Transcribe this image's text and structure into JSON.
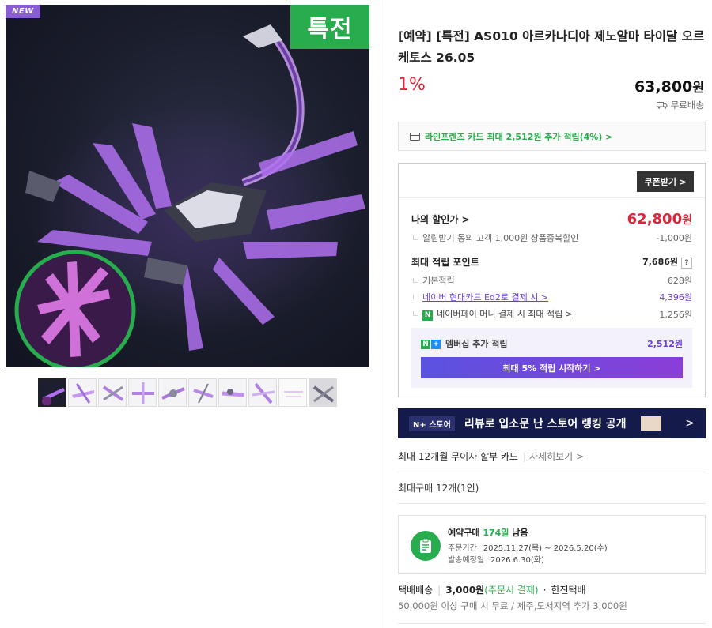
{
  "image": {
    "badge_new": "NEW",
    "badge_special": "특전"
  },
  "product": {
    "title": "[예약] [특전] AS010 아르카나디아 제노알마 타이달 오르케토스 26.05",
    "discount": "1%",
    "price": "63,800",
    "price_unit": "원",
    "shipping": "무료배송"
  },
  "card_benefit": "라인프렌즈 카드 최대 2,512원 추가 적립(4%) >",
  "benefit": {
    "coupon_button": "쿠폰받기 >",
    "my_price_label": "나의 할인가 >",
    "my_price": "62,800",
    "my_price_unit": "원",
    "alarm_label": "알림받기 동의 고객 1,000원 상품중복할인",
    "alarm_value": "-1,000원",
    "max_point_label": "최대 적립 포인트",
    "max_point_value": "7,686원",
    "help": "?",
    "base_label": "기본적립",
    "base_value": "628원",
    "hyundai_label": "네이버 현대카드 Ed2로 결제 시 >",
    "hyundai_value": "4,396원",
    "npay_icon": "N",
    "npay_label": "네이버페이 머니 결제 시 최대 적립 >",
    "npay_value": "1,256원",
    "member_n": "N",
    "member_plus": "+",
    "member_label": "멤버십 추가 적립",
    "member_value": "2,512원",
    "member_button": "최대 5% 적립 시작하기 >"
  },
  "banner": {
    "logo": "N+ 스토어",
    "text": "리뷰로 입소문 난 스토어 랭킹 공개",
    "arrow": ">"
  },
  "installment": {
    "label": "최대 12개월 무이자 할부 카드",
    "more": "자세히보기 >"
  },
  "max_buy": "최대구매 12개(1인)",
  "preorder": {
    "title_prefix": "예약구매",
    "days": "174일",
    "title_suffix": "남음",
    "order_key": "주문기간",
    "order_value": "2025.11.27(목) ~ 2026.5.20(수)",
    "ship_key": "발송예정일",
    "ship_value": "2026.6.30(화)"
  },
  "delivery": {
    "type": "택배배송",
    "fee": "3,000원",
    "fee_note": "(주문시 결제)",
    "courier": "한진택배",
    "note": "50,000원 이상 구매 시 무료 / 제주,도서지역 추가 3,000원"
  },
  "colors": {
    "accent_green": "#27ad4d",
    "price_red": "#e0243a",
    "purple": "#6c3fd8",
    "banner_navy": "#141a4a"
  }
}
